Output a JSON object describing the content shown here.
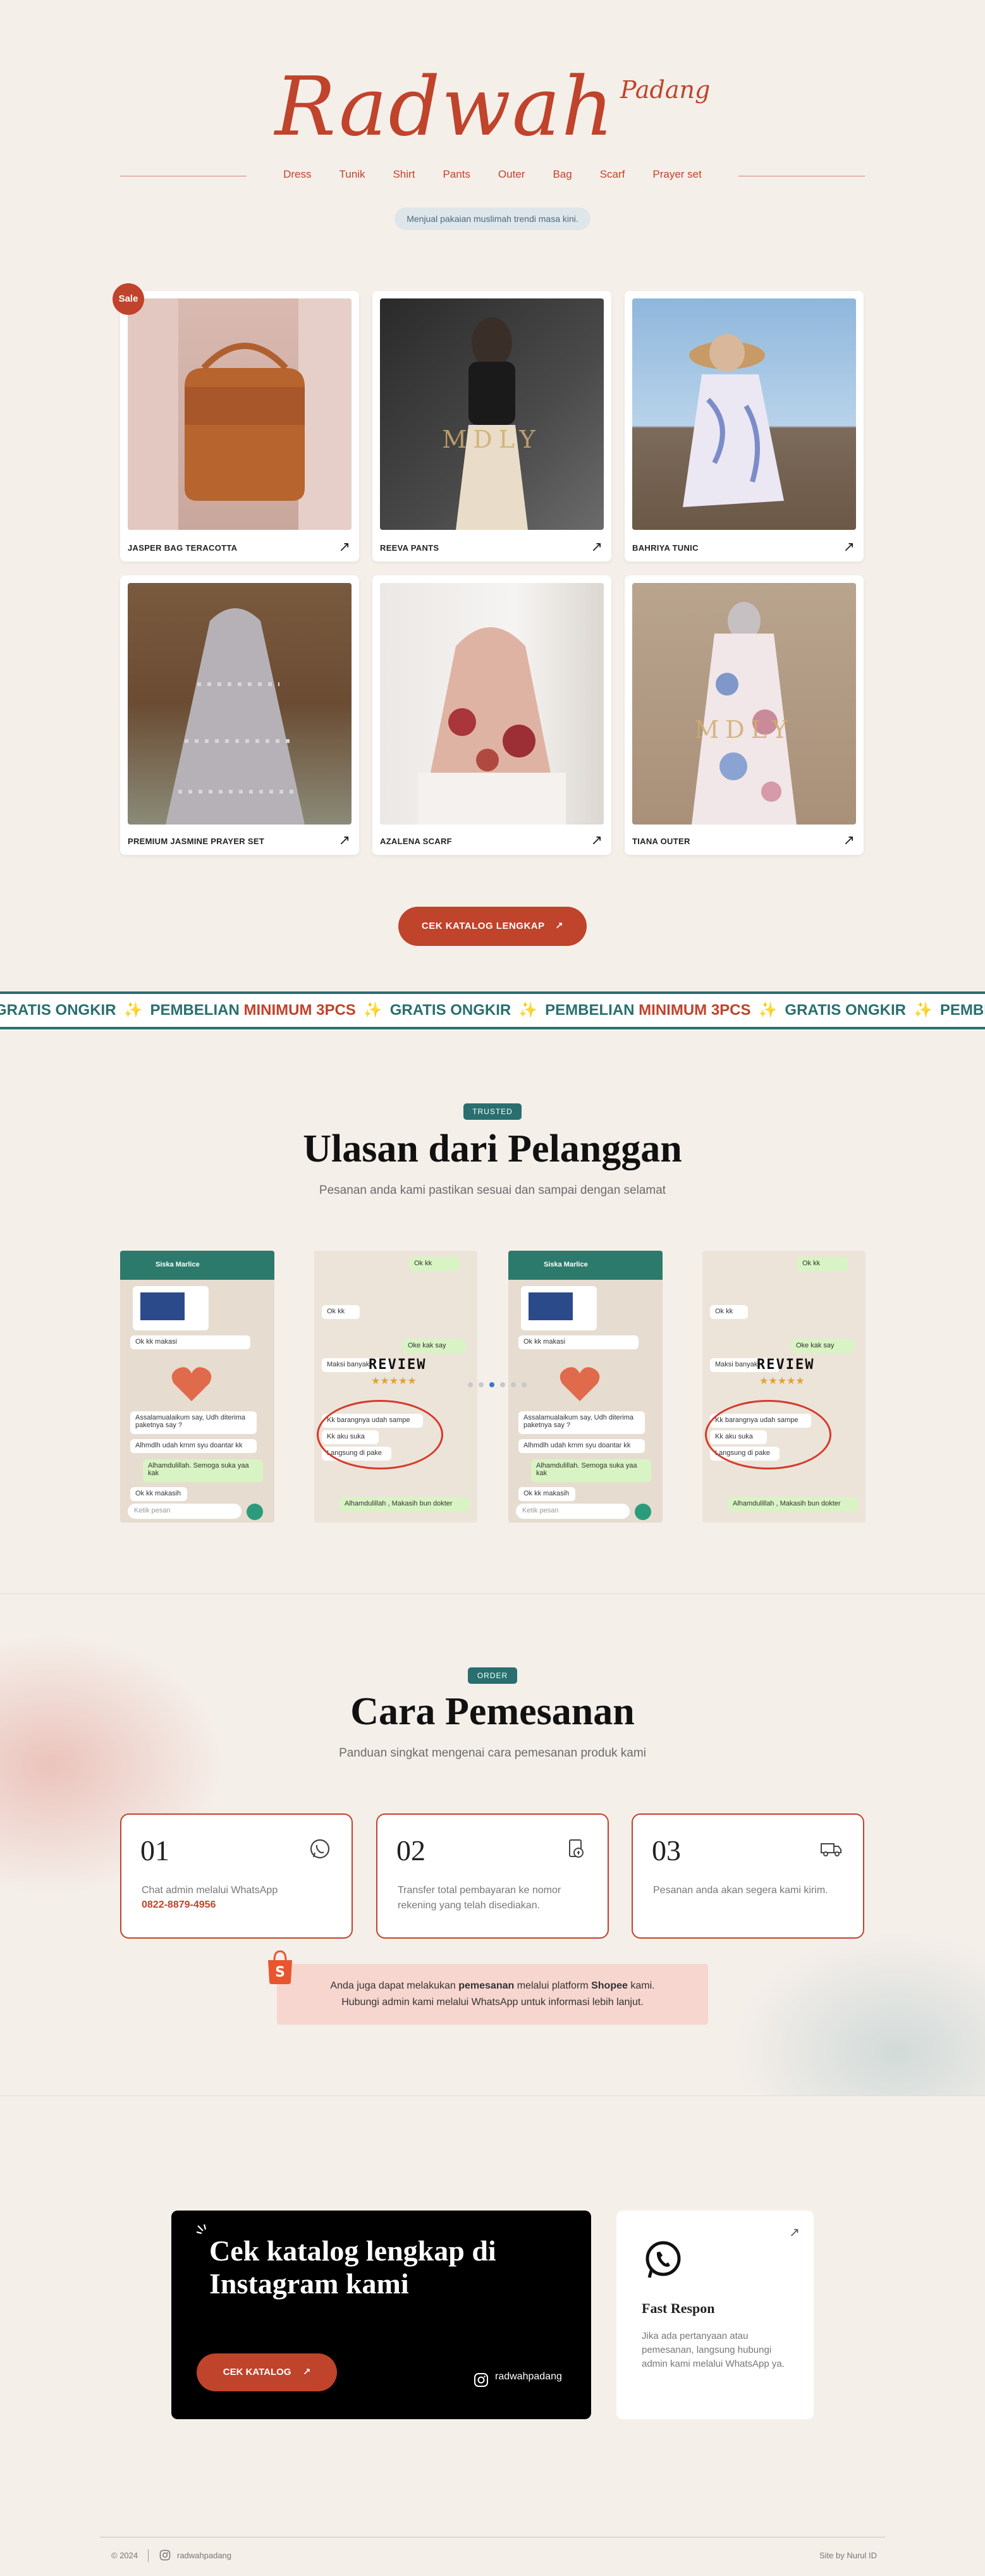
{
  "brand": {
    "name": "Radwah",
    "city": "Padang"
  },
  "nav": [
    "Dress",
    "Tunik",
    "Shirt",
    "Pants",
    "Outer",
    "Bag",
    "Scarf",
    "Prayer set"
  ],
  "tagline": "Menjual pakaian muslimah trendi masa kini.",
  "products": {
    "sale_badge": "Sale",
    "watermark": "MDLY",
    "arrow": "↗",
    "items": [
      {
        "name": "JASPER BAG TERACOTTA"
      },
      {
        "name": "REEVA PANTS"
      },
      {
        "name": "BAHRIYA TUNIC"
      },
      {
        "name": "PREMIUM JASMINE PRAYER SET"
      },
      {
        "name": "AZALENA SCARF"
      },
      {
        "name": "TIANA OUTER"
      }
    ]
  },
  "catalog_button": "CEK KATALOG LENGKAP",
  "marquee": {
    "part1": "GRATIS ONGKIR",
    "part2": "PEMBELIAN",
    "part3": "MINIMUM 3PCS",
    "star": "✨"
  },
  "reviews": {
    "badge": "TRUSTED",
    "title": "Ulasan dari Pelanggan",
    "subtitle": "Pesanan anda kami pastikan sesuai dan sampai dengan selamat",
    "review_word": "REVIEW",
    "contact": "Siska Marlice",
    "chat_a": [
      "Ok kk",
      "Oke kak say",
      "Maksi banyak",
      "Kk barangnya udah sampe",
      "Kk aku suka",
      "Langsung di pake",
      "Alhamdulillah , Makasih bun dokter"
    ],
    "chat_b": [
      "Ok kk makasi",
      "Assalamualaikum say, Udh diterima paketnya say ?",
      "Alhmdlh udah krnm syu doantar kk",
      "Alhamdulillah. Semoga suka yaa kak",
      "Ok kk makasih",
      "Ketik pesan"
    ]
  },
  "order": {
    "badge": "ORDER",
    "title": "Cara Pemesanan",
    "subtitle": "Panduan singkat mengenai cara pemesanan produk kami",
    "steps": [
      {
        "num": "01",
        "text": "Chat admin melalui WhatsApp",
        "phone": "0822-8879-4956",
        "icon": "whatsapp-icon"
      },
      {
        "num": "02",
        "text": "Transfer total pembayaran ke nomor rekening yang telah disediakan.",
        "icon": "payment-icon"
      },
      {
        "num": "03",
        "text": "Pesanan anda akan segera kami kirim.",
        "icon": "truck-icon"
      }
    ],
    "shopee_line1_a": "Anda juga dapat melakukan ",
    "shopee_line1_b": "pemesanan",
    "shopee_line1_c": " melalui platform ",
    "shopee_line1_d": "Shopee",
    "shopee_line1_e": " kami.",
    "shopee_line2": "Hubungi admin kami melalui WhatsApp untuk informasi lebih lanjut."
  },
  "instagram_card": {
    "title": "Cek katalog lengkap di Instagram kami",
    "button": "CEK KATALOG",
    "handle": "radwahpadang"
  },
  "fast_card": {
    "title": "Fast Respon",
    "text": "Jika ada pertanyaan atau pemesanan, langsung hubungi admin kami melalui WhatsApp ya."
  },
  "footer": {
    "copyright": "© 2024",
    "instagram": "radwahpadang",
    "credit": "Site by Nurul ID"
  },
  "colors": {
    "accent": "#c0432b",
    "teal": "#2a6f6f",
    "background": "#f5efea"
  }
}
